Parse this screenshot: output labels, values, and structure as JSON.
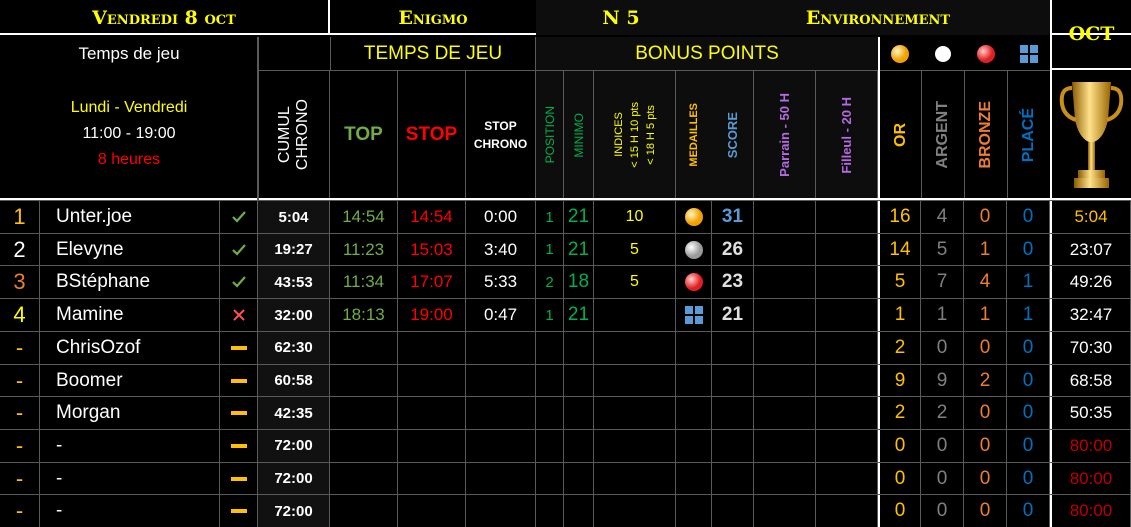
{
  "colors": {
    "yellow": "#ffff00",
    "gold": "#ffc000",
    "green": "#70ad47",
    "bright_green": "#00b050",
    "red": "#ff0000",
    "orange": "#ed7d31",
    "blue": "#5b9bd5",
    "light_blue": "#0070c0",
    "purple": "#b36ae2",
    "gray": "#808080"
  },
  "banner": {
    "date": "Vendredi 8 oct",
    "game": "Enigmo",
    "number": "N 5",
    "theme": "Environnement",
    "month": "OCT"
  },
  "info": {
    "title": "Temps de jeu",
    "days": "Lundi - Vendredi",
    "hours": "11:00 - 19:00",
    "duration": "8 heures"
  },
  "groups": {
    "time": "TEMPS DE JEU",
    "bonus": "BONUS POINTS"
  },
  "columns": {
    "cumul": "CUMUL",
    "chrono": "CHRONO",
    "top": "TOP",
    "stop": "STOP",
    "stop_chrono_1": "STOP",
    "stop_chrono_2": "CHRONO",
    "position": "POSITION",
    "minimo": "MINIMO",
    "indices": "INDICES",
    "indices_15": "< 15 H   10 pts",
    "indices_18": "< 18 H   5 pts",
    "medailles": "MEDAILLES",
    "score": "SCORE",
    "parrain": "Parrain - 50 H",
    "filleul": "Filleul - 20 H",
    "or": "OR",
    "argent": "ARGENT",
    "bronze": "BRONZE",
    "place": "PLACÉ"
  },
  "medal_icons": [
    "gold-medal-icon",
    "silver-medal-icon",
    "bronze-medal-icon",
    "place-grid-icon"
  ],
  "trophy_icon": "trophy-icon",
  "rows": [
    {
      "rank": "1",
      "rank_color": "#ffc000",
      "name": "Unter.joe",
      "status": "check",
      "cumul": "5:04",
      "top": "14:54",
      "stop": "14:54",
      "chrono": "0:00",
      "position": "1",
      "minimo": "21",
      "indices": "10",
      "medal": "gold",
      "score": "31",
      "or": "16",
      "argent": "4",
      "bronze": "0",
      "place": "0",
      "total": "5:04",
      "total_color": "#ffc000"
    },
    {
      "rank": "2",
      "rank_color": "#ffffff",
      "name": "Elevyne",
      "status": "check",
      "cumul": "19:27",
      "top": "11:23",
      "stop": "15:03",
      "chrono": "3:40",
      "position": "1",
      "minimo": "21",
      "indices": "5",
      "medal": "silver",
      "score": "26",
      "or": "14",
      "argent": "5",
      "bronze": "1",
      "place": "0",
      "total": "23:07",
      "total_color": "#ffffff"
    },
    {
      "rank": "3",
      "rank_color": "#ed7d31",
      "name": "BStéphane",
      "status": "check",
      "cumul": "43:53",
      "top": "11:34",
      "stop": "17:07",
      "chrono": "5:33",
      "position": "2",
      "minimo": "18",
      "indices": "5",
      "medal": "bronze",
      "score": "23",
      "or": "5",
      "argent": "7",
      "bronze": "4",
      "place": "1",
      "total": "49:26",
      "total_color": "#ffffff"
    },
    {
      "rank": "4",
      "rank_color": "#ffff00",
      "name": "Mamine",
      "status": "cross",
      "cumul": "32:00",
      "top": "18:13",
      "stop": "19:00",
      "chrono": "0:47",
      "position": "1",
      "minimo": "21",
      "indices": "",
      "medal": "place",
      "score": "21",
      "or": "1",
      "argent": "1",
      "bronze": "1",
      "place": "1",
      "total": "32:47",
      "total_color": "#ffffff"
    },
    {
      "rank": "-",
      "rank_color": "#ffc000",
      "name": "ChrisOzof",
      "status": "dash",
      "cumul": "62:30",
      "top": "",
      "stop": "",
      "chrono": "",
      "position": "",
      "minimo": "",
      "indices": "",
      "medal": "",
      "score": "",
      "or": "2",
      "argent": "0",
      "bronze": "0",
      "place": "0",
      "total": "70:30",
      "total_color": "#ffffff"
    },
    {
      "rank": "-",
      "rank_color": "#ffc000",
      "name": "Boomer",
      "status": "dash",
      "cumul": "60:58",
      "top": "",
      "stop": "",
      "chrono": "",
      "position": "",
      "minimo": "",
      "indices": "",
      "medal": "",
      "score": "",
      "or": "9",
      "argent": "9",
      "bronze": "2",
      "place": "0",
      "total": "68:58",
      "total_color": "#ffffff"
    },
    {
      "rank": "-",
      "rank_color": "#ffc000",
      "name": "Morgan",
      "status": "dash",
      "cumul": "42:35",
      "top": "",
      "stop": "",
      "chrono": "",
      "position": "",
      "minimo": "",
      "indices": "",
      "medal": "",
      "score": "",
      "or": "2",
      "argent": "2",
      "bronze": "0",
      "place": "0",
      "total": "50:35",
      "total_color": "#ffffff"
    },
    {
      "rank": "-",
      "rank_color": "#ffc000",
      "name": "-",
      "status": "dash",
      "cumul": "72:00",
      "top": "",
      "stop": "",
      "chrono": "",
      "position": "",
      "minimo": "",
      "indices": "",
      "medal": "",
      "score": "",
      "or": "0",
      "argent": "0",
      "bronze": "0",
      "place": "0",
      "total": "80:00",
      "total_color": "#c00000"
    },
    {
      "rank": "-",
      "rank_color": "#ffc000",
      "name": "-",
      "status": "dash",
      "cumul": "72:00",
      "top": "",
      "stop": "",
      "chrono": "",
      "position": "",
      "minimo": "",
      "indices": "",
      "medal": "",
      "score": "",
      "or": "0",
      "argent": "0",
      "bronze": "0",
      "place": "0",
      "total": "80:00",
      "total_color": "#c00000"
    },
    {
      "rank": "-",
      "rank_color": "#ffc000",
      "name": "-",
      "status": "dash",
      "cumul": "72:00",
      "top": "",
      "stop": "",
      "chrono": "",
      "position": "",
      "minimo": "",
      "indices": "",
      "medal": "",
      "score": "",
      "or": "0",
      "argent": "0",
      "bronze": "0",
      "place": "0",
      "total": "80:00",
      "total_color": "#c00000"
    }
  ]
}
